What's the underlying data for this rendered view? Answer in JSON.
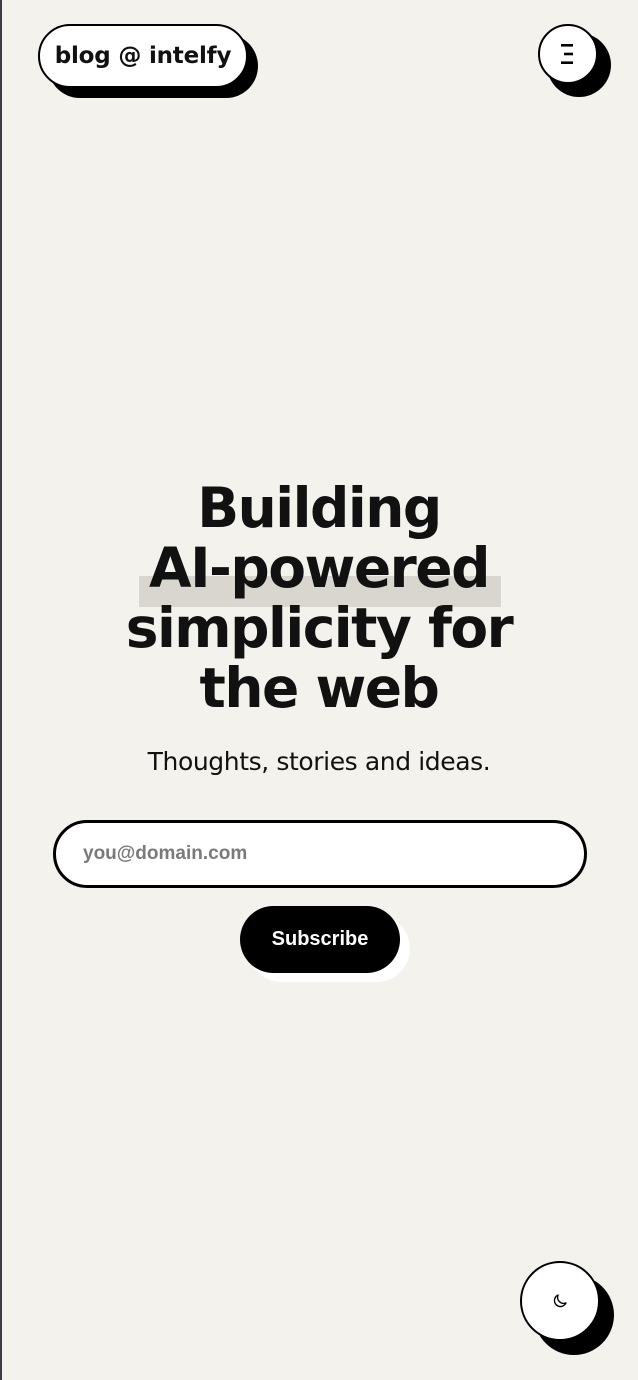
{
  "header": {
    "logo_text": "blog @ intelfy",
    "menu_icon": "hamburger-menu-icon"
  },
  "hero": {
    "title_lines": [
      "Building",
      "AI-powered",
      "simplicity for",
      "the web"
    ],
    "subtitle": "Thoughts, stories and ideas."
  },
  "subscribe": {
    "email_placeholder": "you@domain.com",
    "email_value": "",
    "button_label": "Subscribe"
  },
  "theme_toggle": {
    "icon": "moon-icon"
  },
  "colors": {
    "background": "#f4f2ec",
    "text": "#111111",
    "button_bg": "#000000",
    "highlight": "#d8d6cf"
  }
}
